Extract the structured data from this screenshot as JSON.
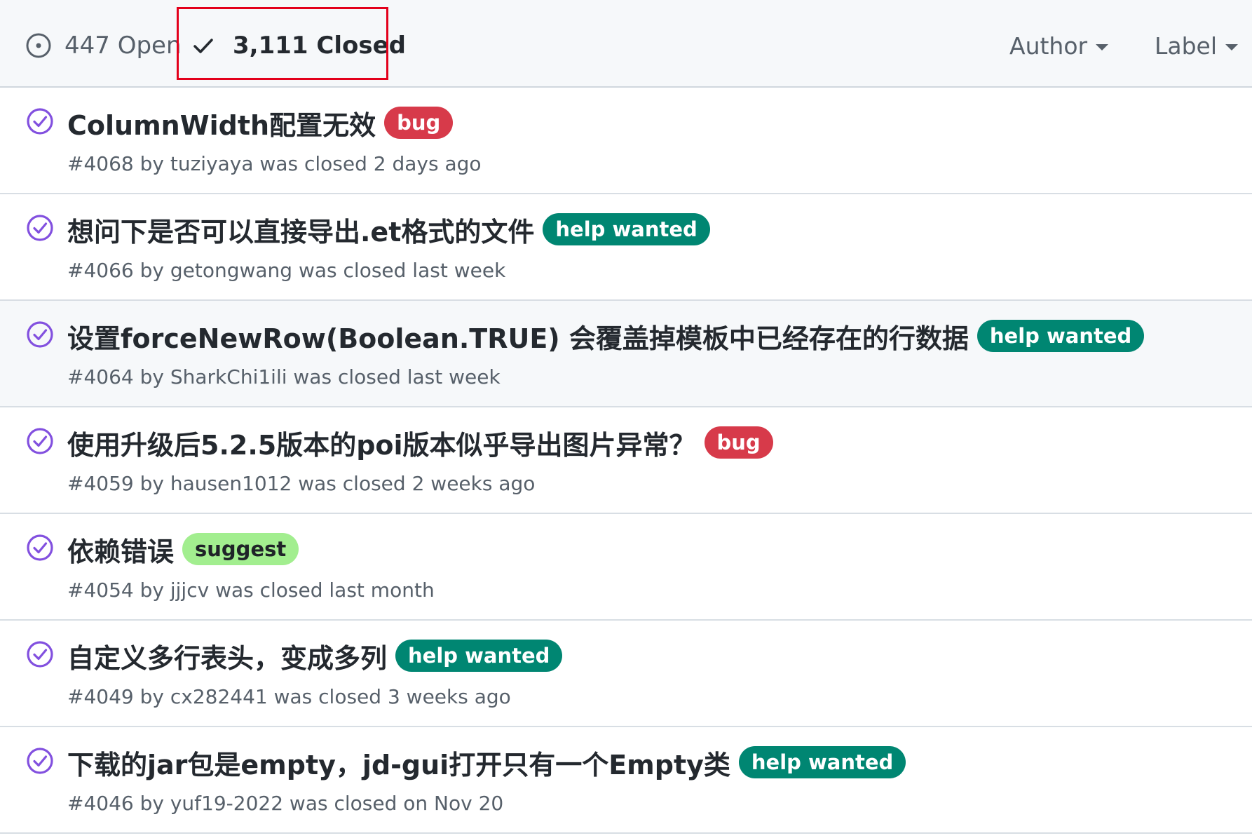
{
  "header": {
    "open_label": "447 Open",
    "closed_label": "3,111 Closed",
    "filters": {
      "author_label": "Author",
      "label_label": "Label"
    }
  },
  "colors": {
    "closed_icon": "#8250df",
    "bug": "#d73a4a",
    "help_wanted": "#008672",
    "suggest": "#a2ee8f",
    "highlight": "#e3001b"
  },
  "issues": [
    {
      "title": "ColumnWidth配置无效",
      "label": "bug",
      "meta": "#4068 by tuziyaya was closed 2 days ago"
    },
    {
      "title": "想问下是否可以直接导出.et格式的文件",
      "label": "help wanted",
      "meta": "#4066 by getongwang was closed last week"
    },
    {
      "title": "设置forceNewRow(Boolean.TRUE) 会覆盖掉模板中已经存在的行数据",
      "label": "help wanted",
      "meta": "#4064 by SharkChi1ili was closed last week"
    },
    {
      "title": "使用升级后5.2.5版本的poi版本似乎导出图片异常？",
      "label": "bug",
      "meta": "#4059 by hausen1012 was closed 2 weeks ago"
    },
    {
      "title": "依赖错误",
      "label": "suggest",
      "meta": "#4054 by jjjcv was closed last month"
    },
    {
      "title": "自定义多行表头，变成多列",
      "label": "help wanted",
      "meta": "#4049 by cx282441 was closed 3 weeks ago"
    },
    {
      "title": "下载的jar包是empty，jd-gui打开只有一个Empty类",
      "label": "help wanted",
      "meta": "#4046 by yuf19-2022 was closed on Nov 20"
    }
  ]
}
